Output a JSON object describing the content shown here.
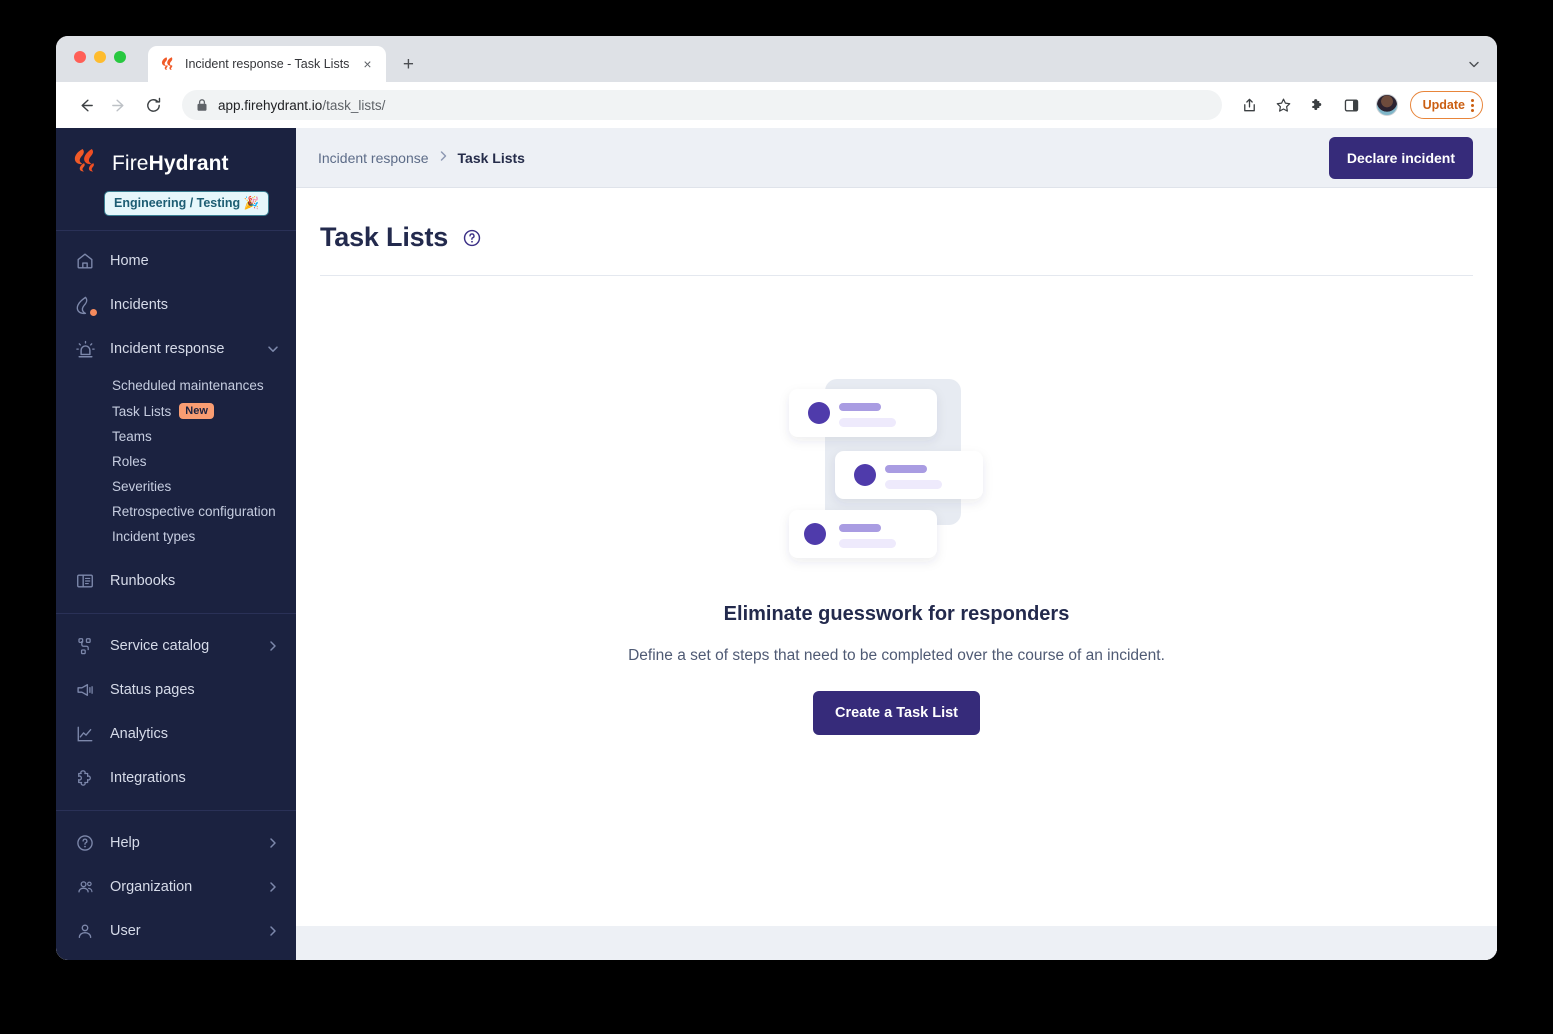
{
  "browser": {
    "tab": {
      "title": "Incident response - Task Lists",
      "favicon": "firehydrant-flame-icon",
      "close_label": "×"
    },
    "new_tab_label": "+",
    "tabstrip_menu_label": "⌄",
    "toolbar": {
      "back_label": "←",
      "forward_label": "→",
      "reload_label": "⟳",
      "url_secure": "app.firehydrant.io",
      "url_path": "/task_lists/",
      "share_icon": "share-icon",
      "bookmark_icon": "star-icon",
      "extensions_icon": "puzzle-piece-icon",
      "sidepanel_icon": "side-panel-icon",
      "profile_icon": "profile-avatar",
      "update_label": "Update",
      "menu_icon": "kebab-menu-icon"
    }
  },
  "sidebar": {
    "brand": {
      "name_light": "Fire",
      "name_bold": "Hydrant",
      "logo_icon": "firehydrant-logo-icon"
    },
    "org_badge": "Engineering / Testing 🎉",
    "items": [
      {
        "label": "Home",
        "icon": "home-icon",
        "chevron": ""
      },
      {
        "label": "Incidents",
        "icon": "flame-icon",
        "chevron": "",
        "alert_dot": true
      },
      {
        "label": "Incident response",
        "icon": "siren-icon",
        "chevron": "down",
        "expanded": true
      },
      {
        "label": "Runbooks",
        "icon": "runbook-icon",
        "chevron": ""
      },
      {
        "label": "Service catalog",
        "icon": "service-catalog-icon",
        "chevron": "right"
      },
      {
        "label": "Status pages",
        "icon": "megaphone-icon",
        "chevron": ""
      },
      {
        "label": "Analytics",
        "icon": "analytics-chart-icon",
        "chevron": ""
      },
      {
        "label": "Integrations",
        "icon": "puzzle-piece-icon",
        "chevron": ""
      },
      {
        "label": "Help",
        "icon": "question-circle-icon",
        "chevron": "right"
      },
      {
        "label": "Organization",
        "icon": "people-icon",
        "chevron": "right"
      },
      {
        "label": "User",
        "icon": "person-icon",
        "chevron": "right"
      }
    ],
    "subnav": [
      {
        "label": "Scheduled maintenances",
        "badge": ""
      },
      {
        "label": "Task Lists",
        "badge": "New"
      },
      {
        "label": "Teams",
        "badge": ""
      },
      {
        "label": "Roles",
        "badge": ""
      },
      {
        "label": "Severities",
        "badge": ""
      },
      {
        "label": "Retrospective configuration",
        "badge": ""
      },
      {
        "label": "Incident types",
        "badge": ""
      }
    ]
  },
  "topbar": {
    "breadcrumb_parent": "Incident response",
    "breadcrumb_separator": "›",
    "breadcrumb_current": "Task Lists",
    "declare_incident_label": "Declare incident"
  },
  "page": {
    "title": "Task Lists",
    "help_icon": "question-circle-icon",
    "empty_state": {
      "illustration": "task-list-cards-illustration",
      "headline": "Eliminate guesswork for responders",
      "description": "Define a set of steps that need to be completed over the course of an incident.",
      "cta_label": "Create a Task List"
    }
  },
  "colors": {
    "sidebar_bg": "#1b2240",
    "accent_purple": "#362b7a",
    "brand_orange": "#f05a28",
    "new_badge": "#f99d72",
    "topbar_bg": "#edf0f5",
    "update_outline": "#e8853a"
  }
}
